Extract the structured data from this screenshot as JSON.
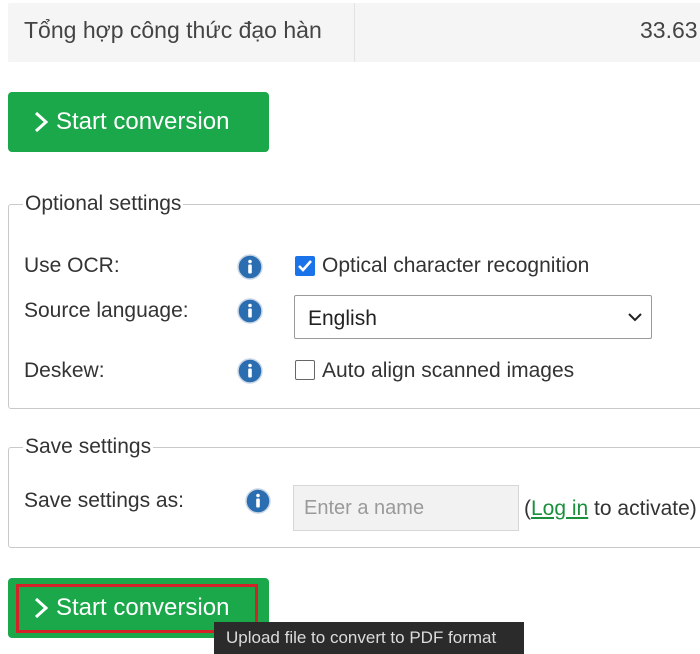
{
  "file": {
    "name": "Tổng hợp công thức đạo hàn",
    "size": "33.63"
  },
  "buttons": {
    "start_label": "Start conversion"
  },
  "optional_settings": {
    "legend": "Optional settings",
    "ocr": {
      "label": "Use OCR:",
      "option": "Optical character recognition",
      "checked": true
    },
    "source_language": {
      "label": "Source language:",
      "selected": "English"
    },
    "deskew": {
      "label": "Deskew:",
      "option": "Auto align scanned images",
      "checked": false
    }
  },
  "save_settings": {
    "legend": "Save settings",
    "label": "Save settings as:",
    "placeholder": "Enter a name",
    "paren_open": "(",
    "login_link": "Log in",
    "activate_text": " to activate)"
  },
  "tooltip": {
    "text": "Upload file to convert to PDF format"
  },
  "colors": {
    "button_green": "#1ba84a",
    "highlight_red": "#d3222a",
    "checkbox_blue": "#1a73e8",
    "link_green": "#1a8f3c",
    "info_blue": "#2a6db0"
  },
  "icons": {
    "info": "info-icon",
    "chevron": "chevron-right-icon",
    "dropdown": "chevron-down-icon"
  }
}
